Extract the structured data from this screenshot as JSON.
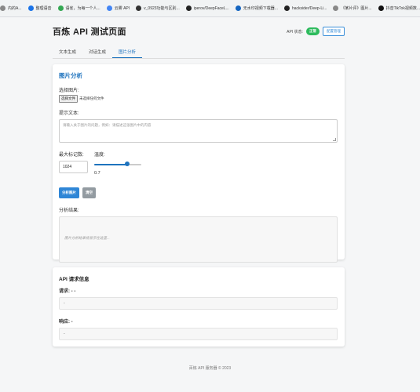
{
  "bookmarks": [
    {
      "label": "内的A...",
      "icon": "globe-icon",
      "color": "#888888"
    },
    {
      "label": "整理语音",
      "icon": "wave-icon",
      "color": "#1a73e8"
    },
    {
      "label": "语雀，为每一个人...",
      "icon": "leaf-icon",
      "color": "#34a853"
    },
    {
      "label": "云雾 API",
      "icon": "cloud-icon",
      "color": "#4285f4"
    },
    {
      "label": "v_0923功能与区别...",
      "icon": "circle-icon",
      "color": "#333333"
    },
    {
      "label": "iperov/DeepFaceL...",
      "icon": "github-icon",
      "color": "#222222"
    },
    {
      "label": "无水印视频下载器...",
      "icon": "download-icon",
      "color": "#1565c0"
    },
    {
      "label": "hacksider/Deep-Li...",
      "icon": "github-icon",
      "color": "#222222"
    },
    {
      "label": "《某片评》图片...",
      "icon": "circle-icon",
      "color": "#888888"
    },
    {
      "label": "抖音TikTok视频数...",
      "icon": "tiktok-icon",
      "color": "#111111"
    },
    {
      "label": "稀空的首页",
      "icon": "blog-icon",
      "color": "#3b5bdb"
    }
  ],
  "header": {
    "title": "百炼 API 测试页面",
    "api_status_label": "API 状态:",
    "status_badge": "正常",
    "config_button": "配置管理"
  },
  "tabs": [
    {
      "label": "文本生成",
      "active": false
    },
    {
      "label": "对话生成",
      "active": false
    },
    {
      "label": "图片分析",
      "active": true
    }
  ],
  "image_analysis": {
    "title": "图片分析",
    "choose_image_label": "选择图片:",
    "file_button": "选择文件",
    "file_status": "未选择任何文件",
    "prompt_label": "提示文本:",
    "prompt_placeholder": "请输入关于图片的问题，例如：请描述这张图片中的内容",
    "max_tokens_label": "最大标记数:",
    "max_tokens_value": "1024",
    "temperature_label": "温度:",
    "temperature_value": "0.7",
    "temperature_fraction": 0.7,
    "analyze_button": "分析图片",
    "clear_button": "清空",
    "result_label": "分析结果:",
    "result_placeholder": "图片分析结果将显示在这里..."
  },
  "api_info": {
    "title": "API 请求信息",
    "request_label": "请求: - -",
    "request_value": "-",
    "response_label": "响应: -",
    "response_value": "-"
  },
  "footer": "百炼 API 服务器 © 2023"
}
